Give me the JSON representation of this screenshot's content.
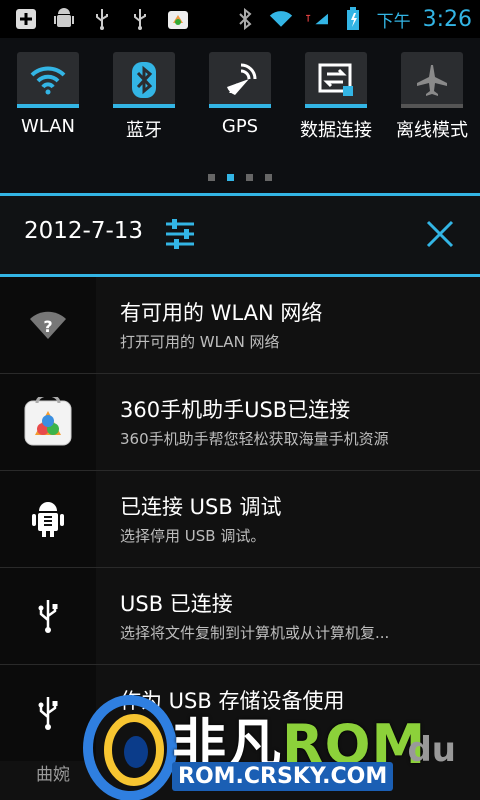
{
  "status_bar": {
    "time_prefix": "下午",
    "time": "3:26",
    "left_icons": [
      "add-icon",
      "android-debug-icon",
      "usb-icon",
      "usb-icon",
      "app-360-icon"
    ],
    "right_icons": [
      "bluetooth-icon",
      "wifi-icon",
      "signal-icon",
      "battery-icon"
    ]
  },
  "quick_settings": {
    "items": [
      {
        "label": "WLAN",
        "icon": "wifi-icon",
        "on": true
      },
      {
        "label": "蓝牙",
        "icon": "bluetooth-icon",
        "on": true
      },
      {
        "label": "GPS",
        "icon": "gps-icon",
        "on": true
      },
      {
        "label": "数据连接",
        "icon": "data-connection-icon",
        "on": true
      },
      {
        "label": "离线模式",
        "icon": "airplane-icon",
        "on": false
      }
    ],
    "page_count": 4,
    "active_page": 2
  },
  "header": {
    "date": "2012-7-13"
  },
  "notifications": [
    {
      "title": "有可用的 WLAN 网络",
      "text": "打开可用的 WLAN 网络",
      "icon": "wifi-question-icon"
    },
    {
      "title": "360手机助手USB已连接",
      "text": "360手机助手帮您轻松获取海量手机资源",
      "icon": "app-360-icon"
    },
    {
      "title": "已连接 USB 调试",
      "text": "选择停用 USB 调试。",
      "icon": "android-debug-icon"
    },
    {
      "title": "USB 已连接",
      "text": "选择将文件复制到计算机或从计算机复...",
      "icon": "usb-icon"
    },
    {
      "title": "作为 USB 存储设备使用",
      "text": "",
      "icon": "usb-icon"
    }
  ],
  "watermark": {
    "brand_cn": "非凡",
    "brand_en": "ROM",
    "url": "ROM.CRSKY.COM",
    "du": "du",
    "bottom_text": "曲婉"
  },
  "colors": {
    "accent": "#33b5e5",
    "background": "#000000"
  }
}
